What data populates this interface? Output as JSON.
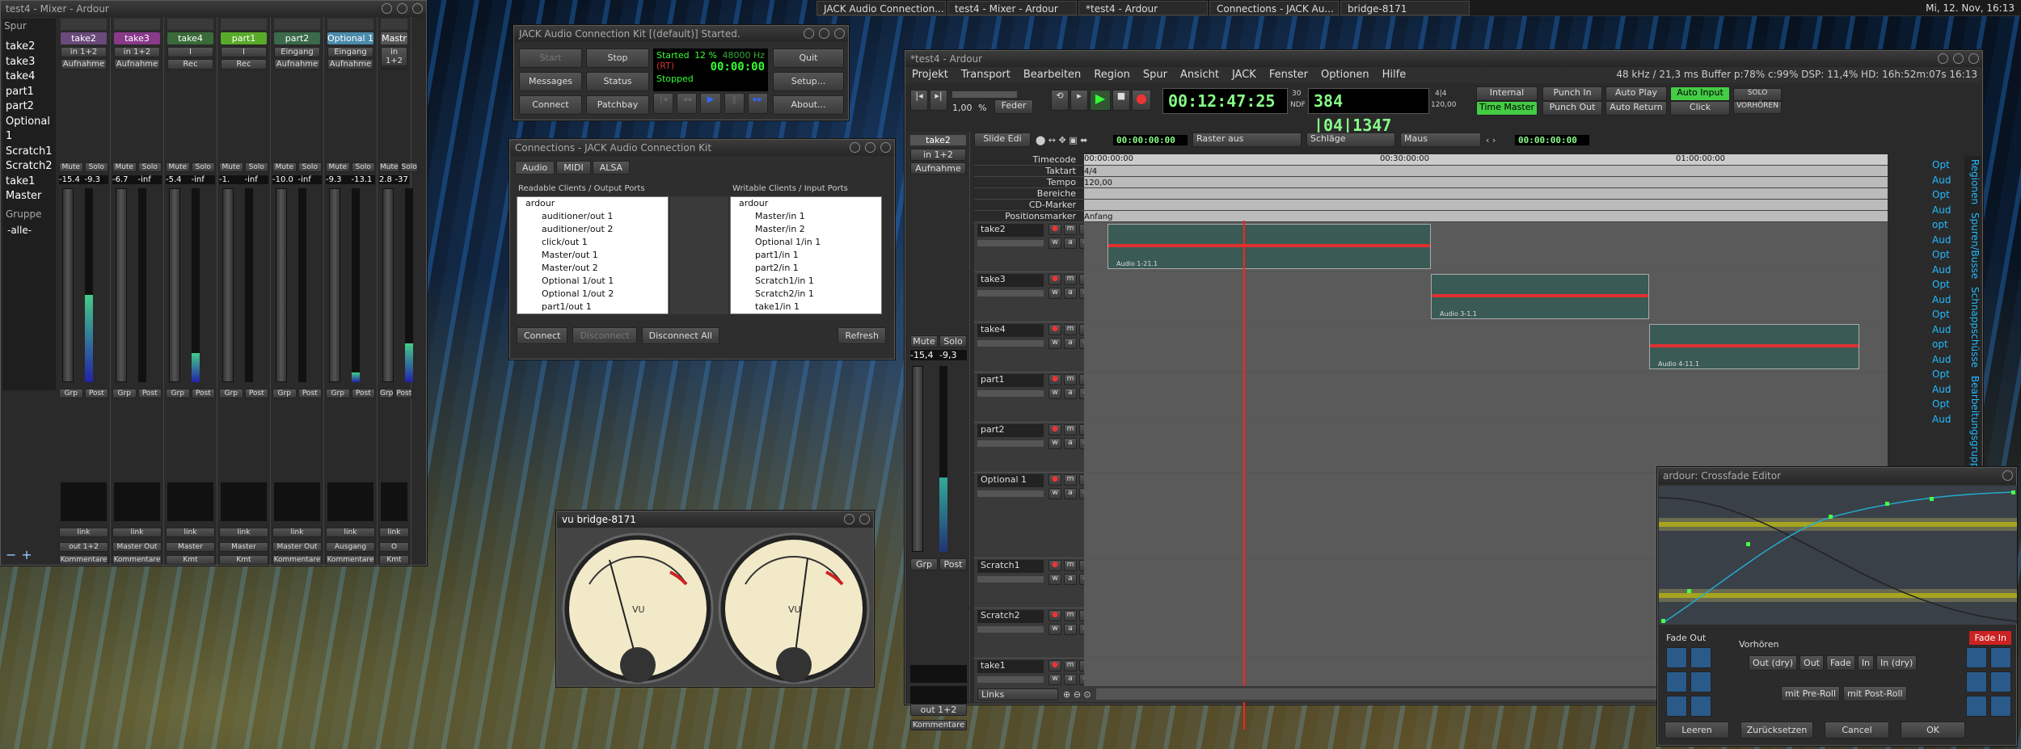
{
  "colors": {
    "accent_green": "#50e050",
    "rec_red": "#c03030",
    "playhead": "#ff2020"
  },
  "taskbar": {
    "tasks": [
      "JACK Audio Connection...",
      "test4 - Mixer - Ardour",
      "*test4 - Ardour",
      "Connections - JACK Au...",
      "bridge-8171"
    ],
    "clock": "Mi, 12. Nov, 16:13"
  },
  "mixer": {
    "title": "test4 - Mixer - Ardour",
    "list_header": "Spur",
    "tracks": [
      "take2",
      "take3",
      "take4",
      "part1",
      "part2",
      "Optional 1",
      "Scratch1",
      "Scratch2",
      "take1",
      "Master"
    ],
    "group_header": "Gruppe",
    "group_all": "-alle-",
    "strips": [
      {
        "name": "take2",
        "color": "#6a4a7a",
        "input": "in 1+2",
        "rec": "Aufnahme",
        "gain": "-15.4",
        "peak": "-9.3",
        "output": "out 1+2",
        "comments": "Kommentare"
      },
      {
        "name": "take3",
        "color": "#8a3a8a",
        "input": "in 1+2",
        "rec": "Aufnahme",
        "gain": "-6.7",
        "peak": "-inf",
        "output": "Master Out",
        "comments": "Kommentare"
      },
      {
        "name": "take4",
        "color": "#3a6a3a",
        "input": "I",
        "rec": "Rec",
        "gain": "-5.4",
        "peak": "-inf",
        "output": "Master",
        "comments": "Kmt"
      },
      {
        "name": "part1",
        "color": "#5aaa2a",
        "input": "I",
        "rec": "Rec",
        "gain": "-1.",
        "peak": "-inf",
        "output": "Master",
        "comments": "Kmt"
      },
      {
        "name": "part2",
        "color": "#3a6a4a",
        "input": "Eingang",
        "rec": "Aufnahme",
        "gain": "-10.0",
        "peak": "-inf",
        "output": "Master Out",
        "comments": "Kommentare"
      },
      {
        "name": "Optional 1",
        "color": "#4a8aaa",
        "input": "Eingang",
        "rec": "Aufnahme",
        "gain": "-9.3",
        "peak": "-13.1",
        "output": "Ausgang",
        "comments": "Kommentare"
      },
      {
        "name": "Mastr",
        "color": "#555",
        "input": "in 1+2",
        "rec": "",
        "gain": "2.8",
        "peak": "-37",
        "output": "O",
        "comments": "Kmt"
      }
    ],
    "labels": {
      "mute": "Mute",
      "solo": "Solo",
      "grp": "Grp",
      "post": "Post",
      "link": "link"
    }
  },
  "jack": {
    "title": "JACK Audio Connection Kit [(default)] Started.",
    "start": "Start",
    "stop": "Stop",
    "messages": "Messages",
    "status": "Status",
    "connect": "Connect",
    "patchbay": "Patchbay",
    "quit": "Quit",
    "setup": "Setup...",
    "about": "About...",
    "state_started": "Started",
    "dsp": "12 %",
    "rate": "48000 Hz",
    "rt": "(RT)",
    "time": "00:00:00",
    "state_stopped": "Stopped"
  },
  "connections": {
    "title": "Connections - JACK Audio Connection Kit",
    "tabs": [
      "Audio",
      "MIDI",
      "ALSA"
    ],
    "readable": "Readable Clients / Output Ports",
    "writable": "Writable Clients / Input Ports",
    "outputs": [
      "ardour",
      "auditioner/out 1",
      "auditioner/out 2",
      "click/out 1",
      "Master/out 1",
      "Master/out 2",
      "Optional 1/out 1",
      "Optional 1/out 2",
      "part1/out 1"
    ],
    "inputs": [
      "ardour",
      "Master/in 1",
      "Master/in 2",
      "Optional 1/in 1",
      "part1/in 1",
      "part2/in 1",
      "Scratch1/in 1",
      "Scratch2/in 1",
      "take1/in 1"
    ],
    "connect": "Connect",
    "disconnect": "Disconnect",
    "disconnect_all": "Disconnect All",
    "refresh": "Refresh"
  },
  "vu": {
    "title": "vu bridge-8171",
    "label_l": "VU",
    "label_r": "VU"
  },
  "ardour": {
    "title": "*test4 - Ardour",
    "menu": [
      "Projekt",
      "Transport",
      "Bearbeiten",
      "Region",
      "Spur",
      "Ansicht",
      "JACK",
      "Fenster",
      "Optionen",
      "Hilfe"
    ],
    "status": "48 kHz / 21,3 ms  Buffer p:78% c:99%  DSP: 11,4%  HD: 16h:52m:07s  16:13",
    "shuttle_speed": "1,00",
    "shuttle_pct": "%",
    "shuttle_mode": "Feder",
    "clock_main": "00:12:47:25",
    "fps": "30",
    "ndf": "NDF",
    "clock_bbt": "384 |04|1347",
    "meter": "4|4",
    "tempo": "120,00",
    "sync": "Internal",
    "time_master": "Time Master",
    "punch_in": "Punch In",
    "punch_out": "Punch Out",
    "auto_play": "Auto Play",
    "auto_return": "Auto Return",
    "auto_input": "Auto Input",
    "click": "Click",
    "solo": "SOLO",
    "audition": "VORHÖREN",
    "edit_mode": "Slide Edi",
    "nudge_clock": "00:00:00:00",
    "snap": "Raster aus",
    "snap_type": "Schläge",
    "edit_point": "Maus",
    "edit_clock": "00:00:00:00",
    "rulers": [
      "Timecode",
      "Taktart",
      "Tempo",
      "Bereiche",
      "CD-Marker",
      "Positionsmarker"
    ],
    "ruler_vals": {
      "timecode": [
        "00:00:00:00",
        "00:30:00:00",
        "01:00:00:00"
      ],
      "taktart": "4/4",
      "tempo": "120,00",
      "pos": "Anfang"
    },
    "tracks": [
      "take2",
      "take3",
      "take4",
      "part1",
      "part2",
      "Optional 1",
      "Scratch1",
      "Scratch2",
      "take1"
    ],
    "regions": [
      "Audio 1-21.1",
      "Audio 3-1.1",
      "Audio 4-11.1"
    ],
    "editor_mixer": {
      "name": "take2",
      "input": "in 1+2",
      "rec": "Aufnahme",
      "mute": "Mute",
      "solo": "Solo",
      "gain": "-15,4",
      "peak": "-9,3",
      "grp": "Grp",
      "post": "Post",
      "output": "out 1+2",
      "comments": "Kommentare"
    },
    "bottom": "Links",
    "side_tabs": [
      "Regionen",
      "Spuren/Busse",
      "Schnappschüsse",
      "Bearbeitungsgruppen"
    ],
    "side_list": [
      "Opt",
      "Aud",
      "Opt",
      "Aud",
      "opt",
      "Aud",
      "Opt",
      "Aud",
      "Opt",
      "Aud",
      "Opt",
      "Aud",
      "opt",
      "Aud",
      "Opt",
      "Aud",
      "Opt",
      "Aud"
    ]
  },
  "xfade": {
    "title": "ardour: Crossfade Editor",
    "fade_out": "Fade Out",
    "fade_in": "Fade In",
    "vorhoeren": "Vorhören",
    "audition_btns": [
      "Out (dry)",
      "Out",
      "Fade",
      "In",
      "In (dry)"
    ],
    "preroll": "mit Pre-Roll",
    "postroll": "mit Post-Roll",
    "clear": "Leeren",
    "reset": "Zurücksetzen",
    "cancel": "Cancel",
    "ok": "OK"
  }
}
